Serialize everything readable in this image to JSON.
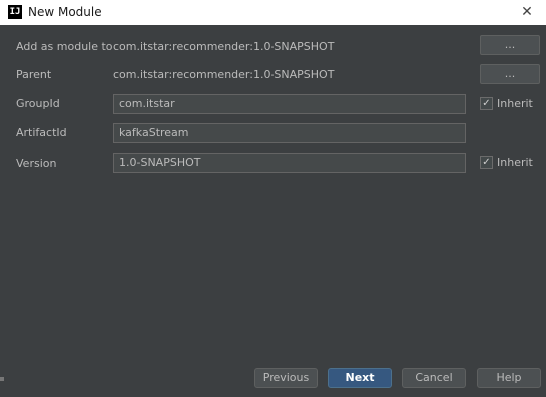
{
  "window": {
    "title": "New Module",
    "app_icon_text": "IJ"
  },
  "form": {
    "add_as_module_to": {
      "label": "Add as module to",
      "value": "com.itstar:recommender:1.0-SNAPSHOT",
      "button": "..."
    },
    "parent": {
      "label": "Parent",
      "value": "com.itstar:recommender:1.0-SNAPSHOT",
      "button": "..."
    },
    "group_id": {
      "label": "GroupId",
      "value": "com.itstar",
      "inherit_label": "Inherit",
      "inherit_checked": true
    },
    "artifact_id": {
      "label": "ArtifactId",
      "value": "kafkaStream"
    },
    "version": {
      "label": "Version",
      "value": "1.0-SNAPSHOT",
      "inherit_label": "Inherit",
      "inherit_checked": true
    }
  },
  "footer": {
    "previous": "Previous",
    "next": "Next",
    "cancel": "Cancel",
    "help": "Help"
  },
  "colors": {
    "background": "#3c3f41",
    "primary_button": "#365880",
    "titlebar": "#ffffff"
  },
  "icons": {
    "close": "close-icon",
    "check": "check-icon",
    "app": "intellij-icon"
  }
}
